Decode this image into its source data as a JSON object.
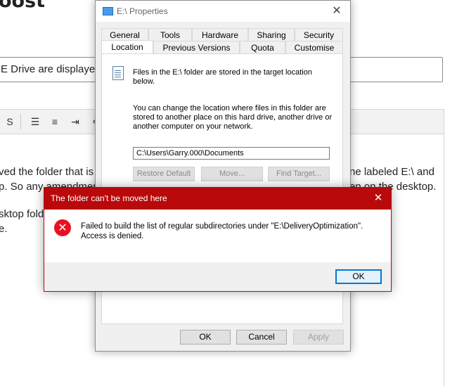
{
  "background": {
    "heading": "oost",
    "input_text": "E Drive are displayed",
    "toolbar_icons": [
      "bullet-list-icon",
      "numbered-list-icon",
      "indent-icon",
      "link-icon",
      "image-icon"
    ],
    "body_lines": [
      "ved the folder that is",
      "p. So any amendmen",
      "sktop fold",
      "e."
    ],
    "right_lines": [
      "ne labeled E:\\ and",
      "en on the desktop."
    ]
  },
  "properties": {
    "title": "E:\\ Properties",
    "tabs_row1": [
      "General",
      "Tools",
      "Hardware",
      "Sharing",
      "Security"
    ],
    "tabs_row2": [
      "Location",
      "Previous Versions",
      "Quota",
      "Customise"
    ],
    "active_tab": "Location",
    "info_line1": "Files in the E:\\ folder are stored in the target location",
    "info_line2": "below.",
    "desc_line1": "You can change the location where files in this folder are",
    "desc_line2": "stored to another place on this hard drive, another drive or",
    "desc_line3": "another computer on your network.",
    "path": "C:\\Users\\Garry.000\\Documents",
    "restore_default": "Restore Default",
    "move": "Move...",
    "find_target": "Find Target...",
    "ok": "OK",
    "cancel": "Cancel",
    "apply": "Apply"
  },
  "error_dialog": {
    "title": "The folder can't be moved here",
    "message_line1": "Failed to build the list of regular subdirectories under \"E:\\DeliveryOptimization\".",
    "message_line2": "Access is denied.",
    "ok": "OK",
    "accent": "#b9090b",
    "icon_color": "#e81123"
  }
}
